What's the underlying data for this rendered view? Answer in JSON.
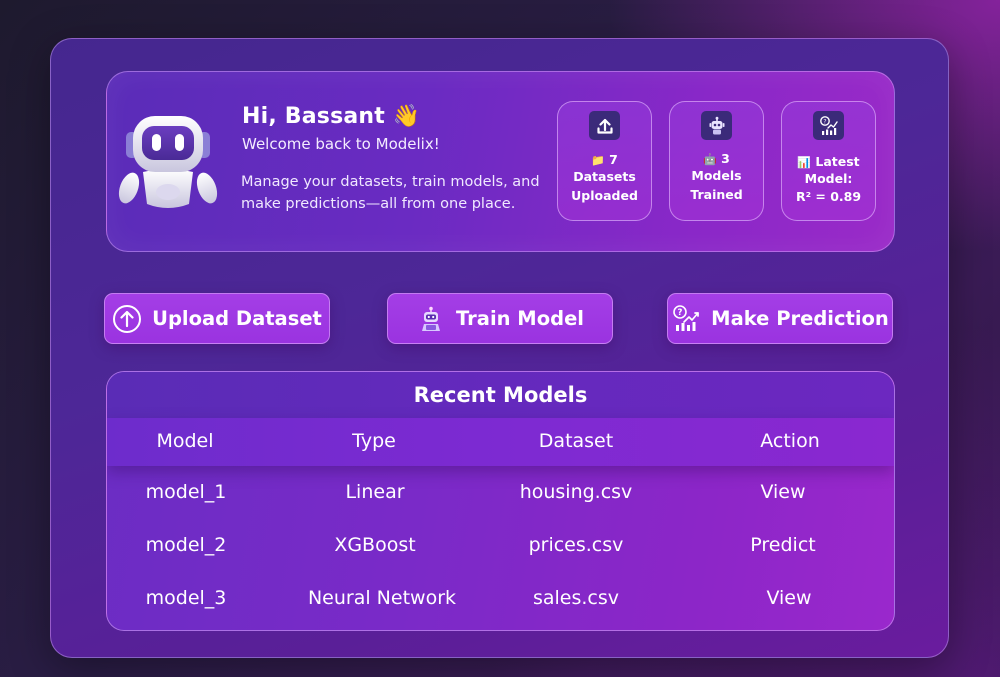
{
  "hero": {
    "greeting": "Hi, Bassant 👋",
    "welcome": "Welcome back to Modelix!",
    "description": "Manage your datasets, train models, and make predictions—all from one place."
  },
  "stats": [
    {
      "icon": "upload-icon",
      "emoji": "📁",
      "line1": "7",
      "line2": "Datasets",
      "line3": "Uploaded"
    },
    {
      "icon": "robot-icon",
      "emoji": "🤖",
      "line1": "3",
      "line2": "Models",
      "line3": "Trained"
    },
    {
      "icon": "prediction-chart-icon",
      "emoji": "📊",
      "line1": "Latest",
      "line2": "Model:",
      "line3": "R² = 0.89"
    }
  ],
  "actions": {
    "upload_label": "Upload Dataset",
    "train_label": "Train Model",
    "predict_label": "Make Prediction"
  },
  "table": {
    "title": "Recent Models",
    "columns": [
      "Model",
      "Type",
      "Dataset",
      "Action"
    ],
    "rows": [
      {
        "model": "model_1",
        "type": "Linear",
        "dataset": "housing.csv",
        "action": "View"
      },
      {
        "model": "model_2",
        "type": "XGBoost",
        "dataset": "prices.csv",
        "action": "Predict"
      },
      {
        "model": "model_3",
        "type": "Neural Network",
        "dataset": "sales.csv",
        "action": "View"
      }
    ]
  },
  "colors": {
    "accent": "#9f38e4",
    "panel": "#4d2797",
    "icon_box": "#3b2a7a"
  }
}
